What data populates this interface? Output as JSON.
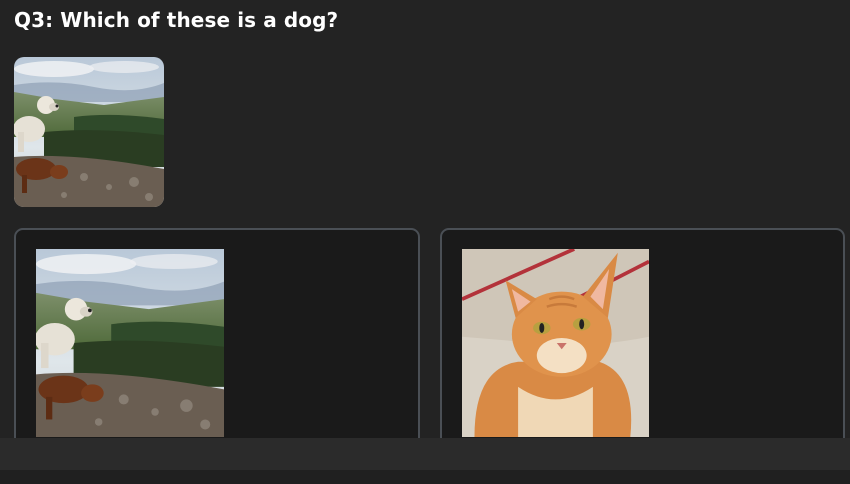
{
  "question": {
    "title": "Q3: Which of these is a dog?"
  },
  "images": {
    "prompt_image": "dogs-on-mountain-image",
    "choices": [
      {
        "id": "choice-1",
        "image": "dogs-on-mountain-image"
      },
      {
        "id": "choice-2",
        "image": "orange-cat-image"
      }
    ]
  },
  "colors": {
    "background": "#232323",
    "card_background": "#1a1a1a",
    "card_border": "#4a4f55",
    "bottom_bar": "#2b2b2b"
  }
}
